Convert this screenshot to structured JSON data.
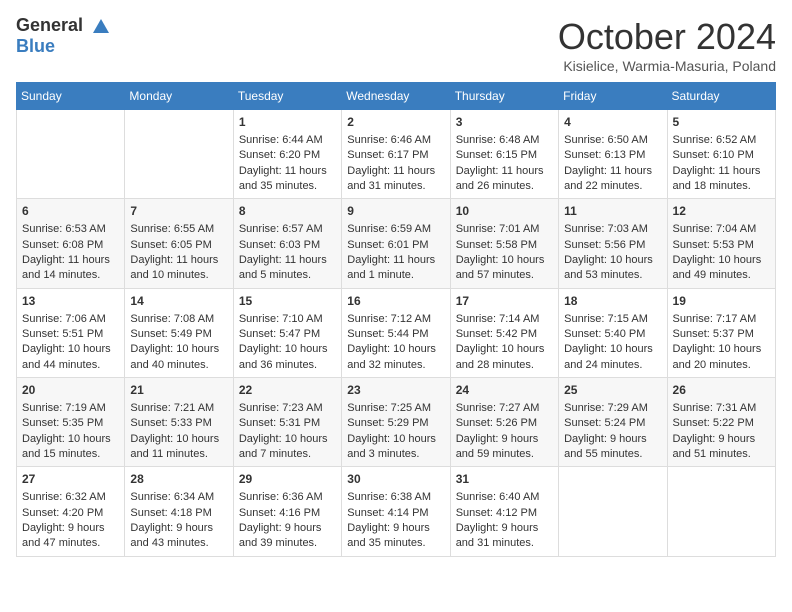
{
  "header": {
    "logo_general": "General",
    "logo_blue": "Blue",
    "month_title": "October 2024",
    "location": "Kisielice, Warmia-Masuria, Poland"
  },
  "days_of_week": [
    "Sunday",
    "Monday",
    "Tuesday",
    "Wednesday",
    "Thursday",
    "Friday",
    "Saturday"
  ],
  "weeks": [
    [
      {
        "day": "",
        "content": ""
      },
      {
        "day": "",
        "content": ""
      },
      {
        "day": "1",
        "content": "Sunrise: 6:44 AM\nSunset: 6:20 PM\nDaylight: 11 hours and 35 minutes."
      },
      {
        "day": "2",
        "content": "Sunrise: 6:46 AM\nSunset: 6:17 PM\nDaylight: 11 hours and 31 minutes."
      },
      {
        "day": "3",
        "content": "Sunrise: 6:48 AM\nSunset: 6:15 PM\nDaylight: 11 hours and 26 minutes."
      },
      {
        "day": "4",
        "content": "Sunrise: 6:50 AM\nSunset: 6:13 PM\nDaylight: 11 hours and 22 minutes."
      },
      {
        "day": "5",
        "content": "Sunrise: 6:52 AM\nSunset: 6:10 PM\nDaylight: 11 hours and 18 minutes."
      }
    ],
    [
      {
        "day": "6",
        "content": "Sunrise: 6:53 AM\nSunset: 6:08 PM\nDaylight: 11 hours and 14 minutes."
      },
      {
        "day": "7",
        "content": "Sunrise: 6:55 AM\nSunset: 6:05 PM\nDaylight: 11 hours and 10 minutes."
      },
      {
        "day": "8",
        "content": "Sunrise: 6:57 AM\nSunset: 6:03 PM\nDaylight: 11 hours and 5 minutes."
      },
      {
        "day": "9",
        "content": "Sunrise: 6:59 AM\nSunset: 6:01 PM\nDaylight: 11 hours and 1 minute."
      },
      {
        "day": "10",
        "content": "Sunrise: 7:01 AM\nSunset: 5:58 PM\nDaylight: 10 hours and 57 minutes."
      },
      {
        "day": "11",
        "content": "Sunrise: 7:03 AM\nSunset: 5:56 PM\nDaylight: 10 hours and 53 minutes."
      },
      {
        "day": "12",
        "content": "Sunrise: 7:04 AM\nSunset: 5:53 PM\nDaylight: 10 hours and 49 minutes."
      }
    ],
    [
      {
        "day": "13",
        "content": "Sunrise: 7:06 AM\nSunset: 5:51 PM\nDaylight: 10 hours and 44 minutes."
      },
      {
        "day": "14",
        "content": "Sunrise: 7:08 AM\nSunset: 5:49 PM\nDaylight: 10 hours and 40 minutes."
      },
      {
        "day": "15",
        "content": "Sunrise: 7:10 AM\nSunset: 5:47 PM\nDaylight: 10 hours and 36 minutes."
      },
      {
        "day": "16",
        "content": "Sunrise: 7:12 AM\nSunset: 5:44 PM\nDaylight: 10 hours and 32 minutes."
      },
      {
        "day": "17",
        "content": "Sunrise: 7:14 AM\nSunset: 5:42 PM\nDaylight: 10 hours and 28 minutes."
      },
      {
        "day": "18",
        "content": "Sunrise: 7:15 AM\nSunset: 5:40 PM\nDaylight: 10 hours and 24 minutes."
      },
      {
        "day": "19",
        "content": "Sunrise: 7:17 AM\nSunset: 5:37 PM\nDaylight: 10 hours and 20 minutes."
      }
    ],
    [
      {
        "day": "20",
        "content": "Sunrise: 7:19 AM\nSunset: 5:35 PM\nDaylight: 10 hours and 15 minutes."
      },
      {
        "day": "21",
        "content": "Sunrise: 7:21 AM\nSunset: 5:33 PM\nDaylight: 10 hours and 11 minutes."
      },
      {
        "day": "22",
        "content": "Sunrise: 7:23 AM\nSunset: 5:31 PM\nDaylight: 10 hours and 7 minutes."
      },
      {
        "day": "23",
        "content": "Sunrise: 7:25 AM\nSunset: 5:29 PM\nDaylight: 10 hours and 3 minutes."
      },
      {
        "day": "24",
        "content": "Sunrise: 7:27 AM\nSunset: 5:26 PM\nDaylight: 9 hours and 59 minutes."
      },
      {
        "day": "25",
        "content": "Sunrise: 7:29 AM\nSunset: 5:24 PM\nDaylight: 9 hours and 55 minutes."
      },
      {
        "day": "26",
        "content": "Sunrise: 7:31 AM\nSunset: 5:22 PM\nDaylight: 9 hours and 51 minutes."
      }
    ],
    [
      {
        "day": "27",
        "content": "Sunrise: 6:32 AM\nSunset: 4:20 PM\nDaylight: 9 hours and 47 minutes."
      },
      {
        "day": "28",
        "content": "Sunrise: 6:34 AM\nSunset: 4:18 PM\nDaylight: 9 hours and 43 minutes."
      },
      {
        "day": "29",
        "content": "Sunrise: 6:36 AM\nSunset: 4:16 PM\nDaylight: 9 hours and 39 minutes."
      },
      {
        "day": "30",
        "content": "Sunrise: 6:38 AM\nSunset: 4:14 PM\nDaylight: 9 hours and 35 minutes."
      },
      {
        "day": "31",
        "content": "Sunrise: 6:40 AM\nSunset: 4:12 PM\nDaylight: 9 hours and 31 minutes."
      },
      {
        "day": "",
        "content": ""
      },
      {
        "day": "",
        "content": ""
      }
    ]
  ]
}
